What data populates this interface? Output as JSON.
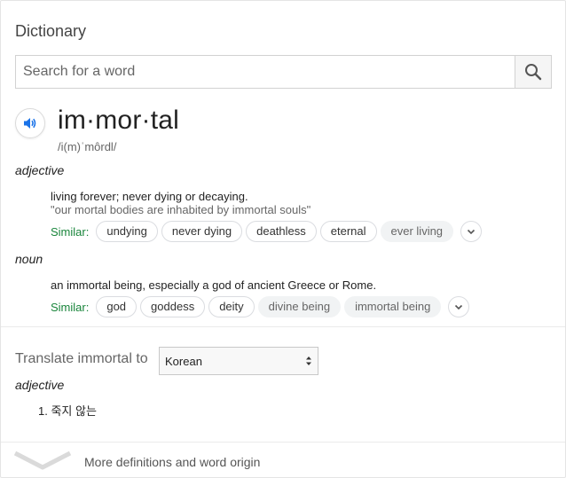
{
  "card": {
    "title": "Dictionary",
    "search": {
      "placeholder": "Search for a word"
    }
  },
  "entry": {
    "word": "im·mor·tal",
    "phonetic": "/i(m)ˈmôrdl/",
    "senses": [
      {
        "pos": "adjective",
        "definition": "living forever; never dying or decaying.",
        "example": "\"our mortal bodies are inhabited by immortal souls\"",
        "similar_label": "Similar:",
        "similar": [
          "undying",
          "never dying",
          "deathless",
          "eternal",
          "ever living"
        ]
      },
      {
        "pos": "noun",
        "definition": "an immortal being, especially a god of ancient Greece or Rome.",
        "similar_label": "Similar:",
        "similar": [
          "god",
          "goddess",
          "deity",
          "divine being",
          "immortal being"
        ]
      }
    ]
  },
  "translate": {
    "label": "Translate immortal to",
    "language": "Korean",
    "pos": "adjective",
    "items": [
      "1. 죽지 않는"
    ]
  },
  "footer": {
    "more_label": "More definitions and word origin"
  },
  "colors": {
    "similar_label": "#19853b",
    "speaker_icon": "#1a73e8"
  },
  "icons": {
    "search": "search-icon",
    "speaker": "speaker-icon",
    "expand": "chevron-down-icon",
    "more": "chevron-down-icon",
    "select": "up-down-arrows-icon"
  }
}
